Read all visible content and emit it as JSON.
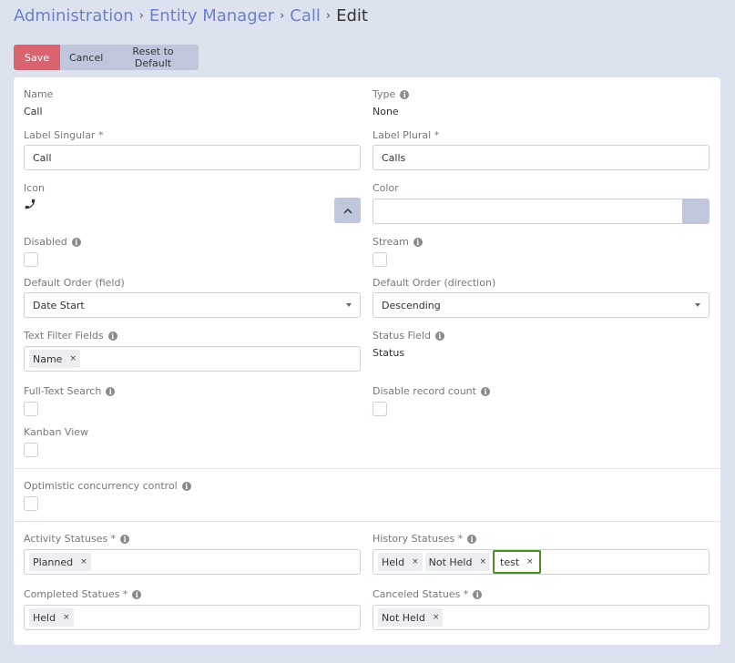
{
  "breadcrumb": {
    "admin": "Administration",
    "entity_manager": "Entity Manager",
    "entity": "Call",
    "current": "Edit",
    "separator": "›"
  },
  "toolbar": {
    "save_label": "Save",
    "cancel_label": "Cancel",
    "reset_label": "Reset to Default"
  },
  "fields": {
    "name": {
      "label": "Name",
      "value": "Call"
    },
    "type": {
      "label": "Type",
      "value": "None"
    },
    "label_singular": {
      "label": "Label Singular *",
      "value": "Call"
    },
    "label_plural": {
      "label": "Label Plural *",
      "value": "Calls"
    },
    "icon": {
      "label": "Icon",
      "icon_name": "phone-icon"
    },
    "color": {
      "label": "Color",
      "value": ""
    },
    "disabled": {
      "label": "Disabled",
      "checked": false
    },
    "stream": {
      "label": "Stream",
      "checked": false
    },
    "default_order_field": {
      "label": "Default Order (field)",
      "value": "Date Start"
    },
    "default_order_direction": {
      "label": "Default Order (direction)",
      "value": "Descending"
    },
    "text_filter_fields": {
      "label": "Text Filter Fields",
      "tags": [
        "Name"
      ]
    },
    "status_field": {
      "label": "Status Field",
      "value": "Status"
    },
    "full_text_search": {
      "label": "Full-Text Search",
      "checked": false
    },
    "disable_record_count": {
      "label": "Disable record count",
      "checked": false
    },
    "kanban_view": {
      "label": "Kanban View",
      "checked": false
    },
    "optimistic_concurrency": {
      "label": "Optimistic concurrency control",
      "checked": false
    },
    "activity_statuses": {
      "label": "Activity Statuses *",
      "tags": [
        "Planned"
      ]
    },
    "history_statuses": {
      "label": "History Statuses *",
      "tags": [
        "Held",
        "Not Held",
        "test"
      ]
    },
    "completed_statuses": {
      "label": "Completed Statues *",
      "tags": [
        "Held"
      ]
    },
    "canceled_statuses": {
      "label": "Canceled Statues *",
      "tags": [
        "Not Held"
      ]
    }
  },
  "icons": {
    "info": "i",
    "remove": "×"
  },
  "colors": {
    "accent": "#6c7fcf",
    "save": "#da6370",
    "secondary": "#c0c7dd",
    "focus": "#4c8f1e",
    "background": "#dde3ee"
  }
}
